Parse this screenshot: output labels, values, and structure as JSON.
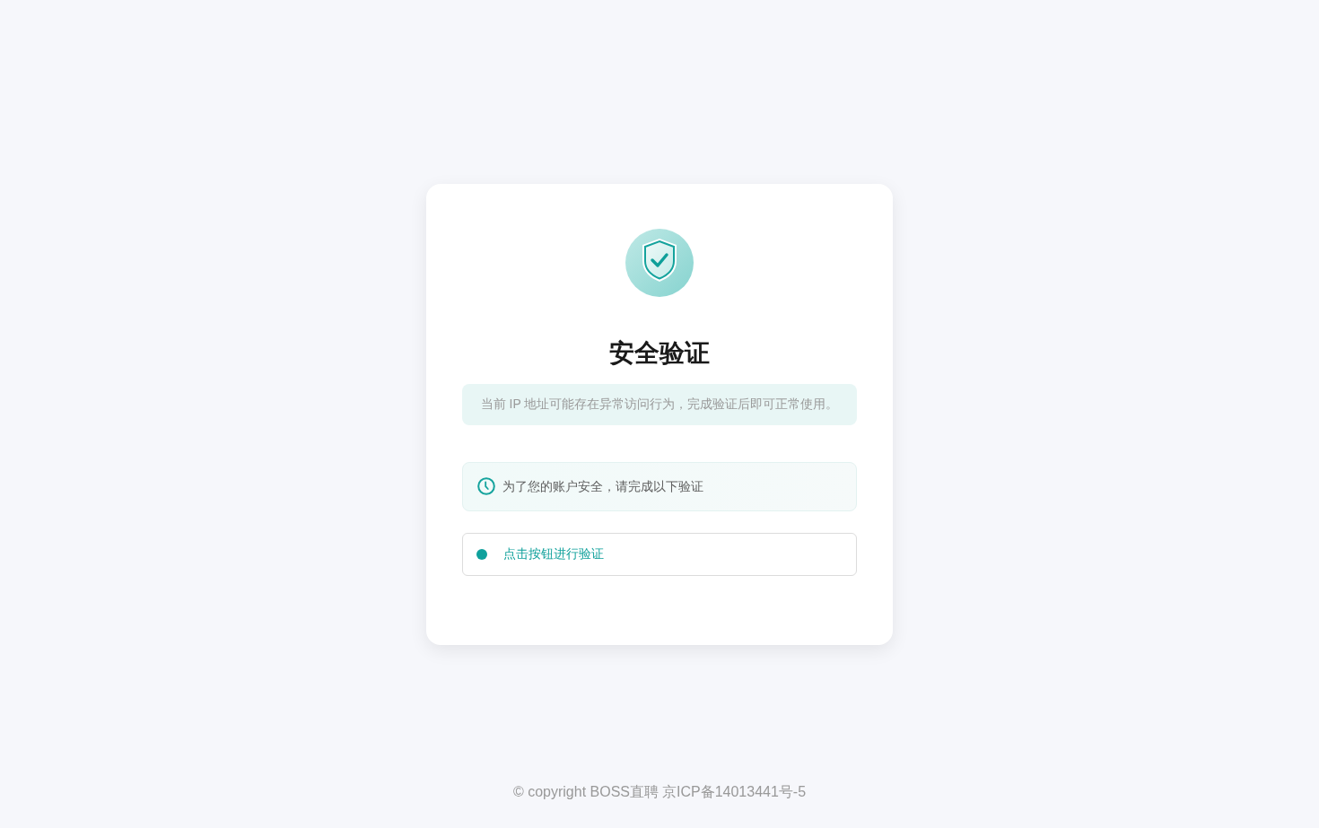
{
  "card": {
    "title": "安全验证",
    "notice": "当前 IP 地址可能存在异常访问行为，完成验证后即可正常使用。",
    "info": "为了您的账户安全，请完成以下验证",
    "verify_button": {
      "label": "点击按钮进行验证"
    }
  },
  "footer": {
    "copyright": "© copyright BOSS直聘",
    "icp_link": "京ICP备14013441号-5"
  }
}
